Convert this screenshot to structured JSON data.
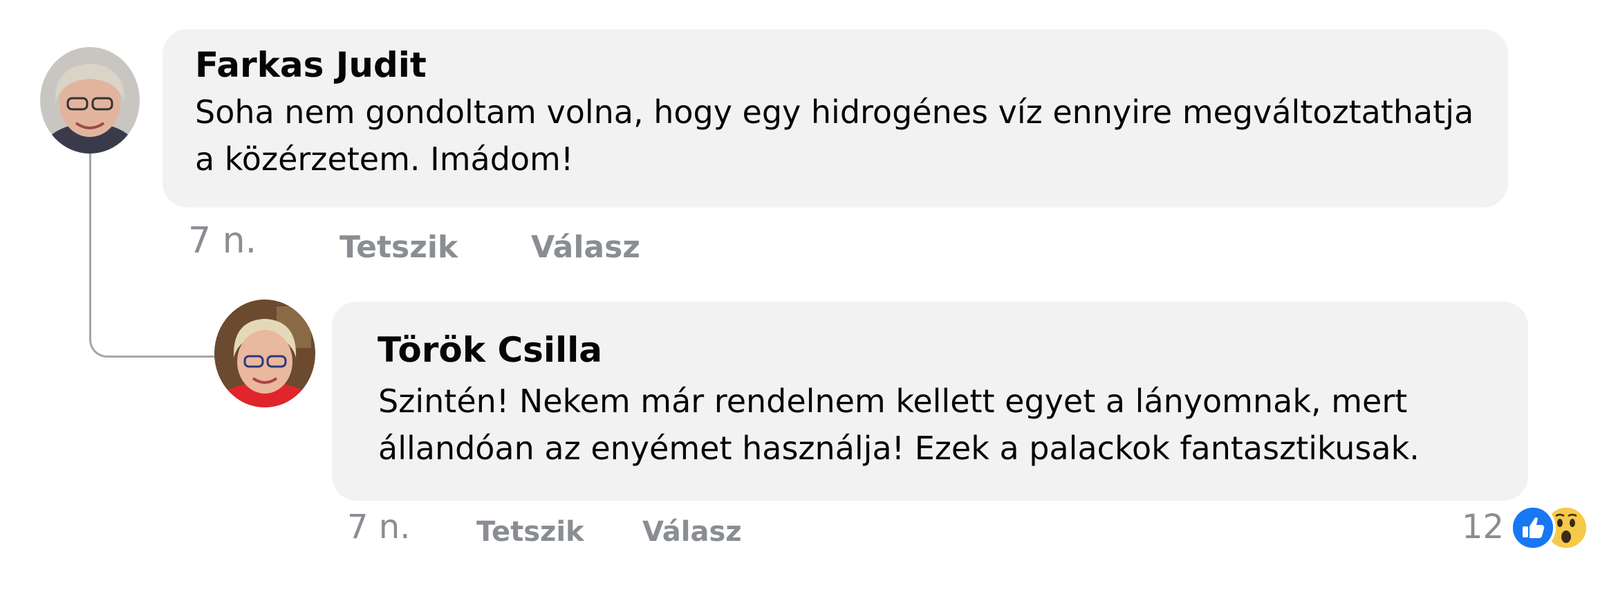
{
  "comments": [
    {
      "author": "Farkas Judit",
      "text": "Soha nem gondoltam volna, hogy egy hidrogénes víz ennyire megváltoztathatja a közérzetem. Imádom!",
      "time": "7 n.",
      "like_label": "Tetszik",
      "reply_label": "Válasz"
    }
  ],
  "reply": {
    "author": "Török Csilla",
    "text_line1": "Szintén! Nekem már rendelnem kellett egyet a lányomnak, mert",
    "text_line2": "állandóan az enyémet használja! Ezek a palackok fantasztikusak.",
    "time": "7 n.",
    "like_label": "Tetszik",
    "reply_label": "Válasz",
    "reaction_count": "12",
    "reactions": [
      "like-icon",
      "wow-icon"
    ]
  },
  "colors": {
    "bubble": "#f2f2f2",
    "meta_text": "#8a8d91",
    "like_blue": "#1877f2",
    "wow_yellow": "#f7c948"
  }
}
